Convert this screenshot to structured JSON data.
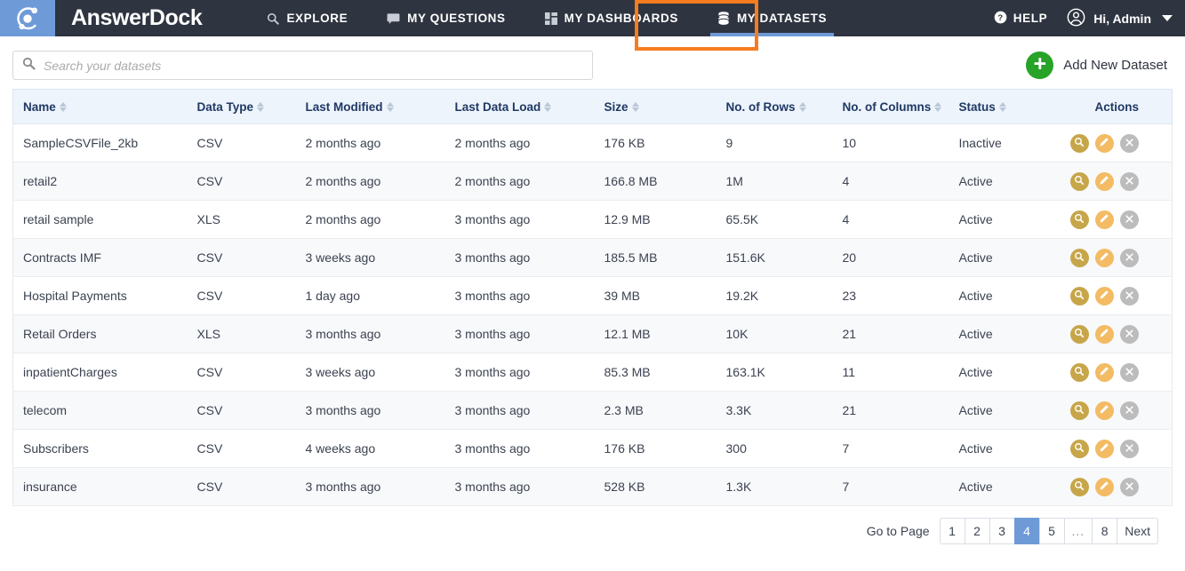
{
  "header": {
    "brand": "AnswerDock",
    "logo_icon": "orbit-logo-icon",
    "nav": [
      {
        "label": "EXPLORE",
        "icon": "search-icon",
        "active": false
      },
      {
        "label": "MY QUESTIONS",
        "icon": "chat-icon",
        "active": false
      },
      {
        "label": "MY DASHBOARDS",
        "icon": "grid-icon",
        "active": false
      },
      {
        "label": "MY DATASETS",
        "icon": "database-icon",
        "active": true
      }
    ],
    "help_label": "HELP",
    "help_icon": "question-circle-icon",
    "user_label": "Hi, Admin",
    "user_icon": "user-circle-icon",
    "caret_icon": "chevron-down-icon",
    "highlight_color": "#f57c1f",
    "accent_color": "#6e9bd8",
    "bar_color": "#2e3440"
  },
  "toolbar": {
    "search_placeholder": "Search your datasets",
    "search_value": "",
    "search_icon": "search-icon",
    "add_label": "Add New Dataset",
    "add_icon": "plus-circle-icon",
    "add_color": "#27a327"
  },
  "table": {
    "columns": [
      {
        "label": "Name",
        "sortable": true
      },
      {
        "label": "Data Type",
        "sortable": true
      },
      {
        "label": "Last Modified",
        "sortable": true
      },
      {
        "label": "Last Data Load",
        "sortable": true
      },
      {
        "label": "Size",
        "sortable": true
      },
      {
        "label": "No. of Rows",
        "sortable": true
      },
      {
        "label": "No. of Columns",
        "sortable": true
      },
      {
        "label": "Status",
        "sortable": true
      },
      {
        "label": "Actions",
        "sortable": false
      }
    ],
    "rows": [
      {
        "name": "SampleCSVFile_2kb",
        "type": "CSV",
        "modified": "2 months ago",
        "loaded": "2 months ago",
        "size": "176 KB",
        "rows": "9",
        "cols": "10",
        "status": "Inactive"
      },
      {
        "name": "retail2",
        "type": "CSV",
        "modified": "2 months ago",
        "loaded": "2 months ago",
        "size": "166.8 MB",
        "rows": "1M",
        "cols": "4",
        "status": "Active"
      },
      {
        "name": "retail sample",
        "type": "XLS",
        "modified": "2 months ago",
        "loaded": "3 months ago",
        "size": "12.9 MB",
        "rows": "65.5K",
        "cols": "4",
        "status": "Active"
      },
      {
        "name": "Contracts IMF",
        "type": "CSV",
        "modified": "3 weeks ago",
        "loaded": "3 months ago",
        "size": "185.5 MB",
        "rows": "151.6K",
        "cols": "20",
        "status": "Active"
      },
      {
        "name": "Hospital Payments",
        "type": "CSV",
        "modified": "1 day ago",
        "loaded": "3 months ago",
        "size": "39 MB",
        "rows": "19.2K",
        "cols": "23",
        "status": "Active"
      },
      {
        "name": "Retail Orders",
        "type": "XLS",
        "modified": "3 months ago",
        "loaded": "3 months ago",
        "size": "12.1 MB",
        "rows": "10K",
        "cols": "21",
        "status": "Active"
      },
      {
        "name": "inpatientCharges",
        "type": "CSV",
        "modified": "3 weeks ago",
        "loaded": "3 months ago",
        "size": "85.3 MB",
        "rows": "163.1K",
        "cols": "11",
        "status": "Active"
      },
      {
        "name": "telecom",
        "type": "CSV",
        "modified": "3 months ago",
        "loaded": "3 months ago",
        "size": "2.3 MB",
        "rows": "3.3K",
        "cols": "21",
        "status": "Active"
      },
      {
        "name": "Subscribers",
        "type": "CSV",
        "modified": "4 weeks ago",
        "loaded": "3 months ago",
        "size": "176 KB",
        "rows": "300",
        "cols": "7",
        "status": "Active"
      },
      {
        "name": "insurance",
        "type": "CSV",
        "modified": "3 months ago",
        "loaded": "3 months ago",
        "size": "528 KB",
        "rows": "1.3K",
        "cols": "7",
        "status": "Active"
      }
    ],
    "row_actions": [
      {
        "name": "view",
        "icon": "magnifier-icon",
        "color": "#c7a64a"
      },
      {
        "name": "edit",
        "icon": "pencil-icon",
        "color": "#f3bb63"
      },
      {
        "name": "delete",
        "icon": "close-x-icon",
        "color": "#bcbcbc"
      }
    ]
  },
  "pagination": {
    "label": "Go to Page",
    "pages": [
      "1",
      "2",
      "3",
      "4",
      "5",
      "...",
      "8",
      "Next"
    ],
    "active_page": "4",
    "active_color": "#6e9bd8"
  }
}
